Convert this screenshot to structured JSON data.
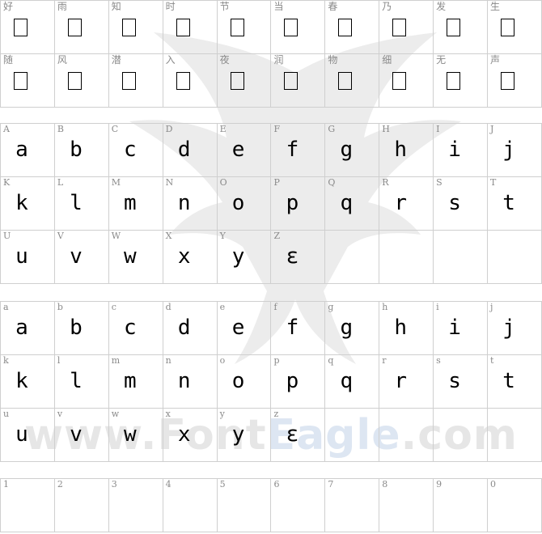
{
  "watermark": {
    "text_gray": "www.Font",
    "text_blue": "Eagle",
    "text_gray2": ".com"
  },
  "cjk_row1": [
    "好",
    "雨",
    "知",
    "时",
    "节",
    "当",
    "春",
    "乃",
    "发",
    "生"
  ],
  "cjk_row2": [
    "随",
    "风",
    "潜",
    "入",
    "夜",
    "润",
    "物",
    "细",
    "无",
    "声"
  ],
  "upper": {
    "labels": [
      "A",
      "B",
      "C",
      "D",
      "E",
      "F",
      "G",
      "H",
      "I",
      "J",
      "K",
      "L",
      "M",
      "N",
      "O",
      "P",
      "Q",
      "R",
      "S",
      "T",
      "U",
      "V",
      "W",
      "X",
      "Y",
      "Z"
    ],
    "glyphs": [
      "a",
      "b",
      "c",
      "d",
      "e",
      "f",
      "g",
      "h",
      "i",
      "j",
      "k",
      "l",
      "m",
      "n",
      "o",
      "p",
      "q",
      "r",
      "s",
      "t",
      "u",
      "v",
      "w",
      "x",
      "y",
      "ε"
    ]
  },
  "lower": {
    "labels": [
      "a",
      "b",
      "c",
      "d",
      "e",
      "f",
      "g",
      "h",
      "i",
      "j",
      "k",
      "l",
      "m",
      "n",
      "o",
      "p",
      "q",
      "r",
      "s",
      "t",
      "u",
      "v",
      "w",
      "x",
      "y",
      "z"
    ],
    "glyphs": [
      "a",
      "b",
      "c",
      "d",
      "e",
      "f",
      "g",
      "h",
      "i",
      "j",
      "k",
      "l",
      "m",
      "n",
      "o",
      "p",
      "q",
      "r",
      "s",
      "t",
      "u",
      "v",
      "w",
      "x",
      "y",
      "ε"
    ]
  },
  "digits": [
    "1",
    "2",
    "3",
    "4",
    "5",
    "6",
    "7",
    "8",
    "9",
    "0"
  ]
}
